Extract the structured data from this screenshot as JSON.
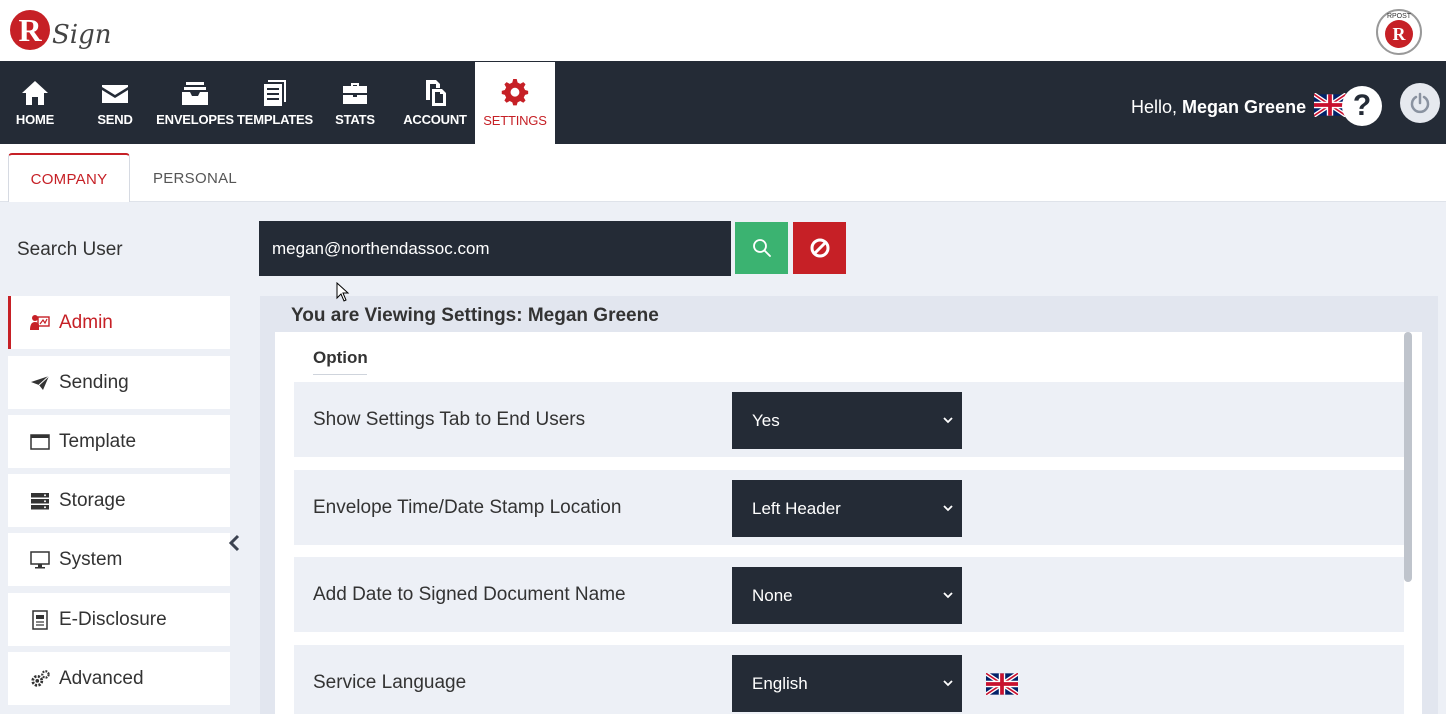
{
  "nav": {
    "items": [
      {
        "label": "HOME",
        "icon": "home-icon"
      },
      {
        "label": "SEND",
        "icon": "envelope-icon"
      },
      {
        "label": "ENVELOPES",
        "icon": "inbox-icon"
      },
      {
        "label": "TEMPLATES",
        "icon": "document-icon"
      },
      {
        "label": "STATS",
        "icon": "briefcase-icon"
      },
      {
        "label": "ACCOUNT",
        "icon": "copy-icon"
      },
      {
        "label": "SETTINGS",
        "icon": "gear-icon",
        "active": true
      }
    ],
    "greeting_prefix": "Hello,",
    "user_name": "Megan Greene",
    "help_glyph": "?"
  },
  "tabs": {
    "company": "COMPANY",
    "personal": "PERSONAL"
  },
  "search": {
    "label": "Search User",
    "value": "megan@northendassoc.com"
  },
  "sidebar": {
    "items": [
      {
        "label": "Admin",
        "icon": "admin-icon",
        "active": true
      },
      {
        "label": "Sending",
        "icon": "paper-plane-icon"
      },
      {
        "label": "Template",
        "icon": "window-icon"
      },
      {
        "label": "Storage",
        "icon": "server-icon"
      },
      {
        "label": "System",
        "icon": "monitor-icon"
      },
      {
        "label": "E-Disclosure",
        "icon": "document-list-icon"
      },
      {
        "label": "Advanced",
        "icon": "gears-icon"
      }
    ]
  },
  "panel": {
    "title": "You are Viewing Settings: Megan Greene",
    "option_header": "Option",
    "rows": [
      {
        "label": "Show Settings Tab to End Users",
        "value": "Yes"
      },
      {
        "label": "Envelope Time/Date Stamp Location",
        "value": "Left Header"
      },
      {
        "label": "Add Date to Signed Document Name",
        "value": "None"
      },
      {
        "label": "Service Language",
        "value": "English"
      }
    ]
  },
  "colors": {
    "brand_red": "#c62026",
    "nav_dark": "#242b36",
    "search_green": "#3bb371",
    "panel_bg": "#edf0f6"
  }
}
